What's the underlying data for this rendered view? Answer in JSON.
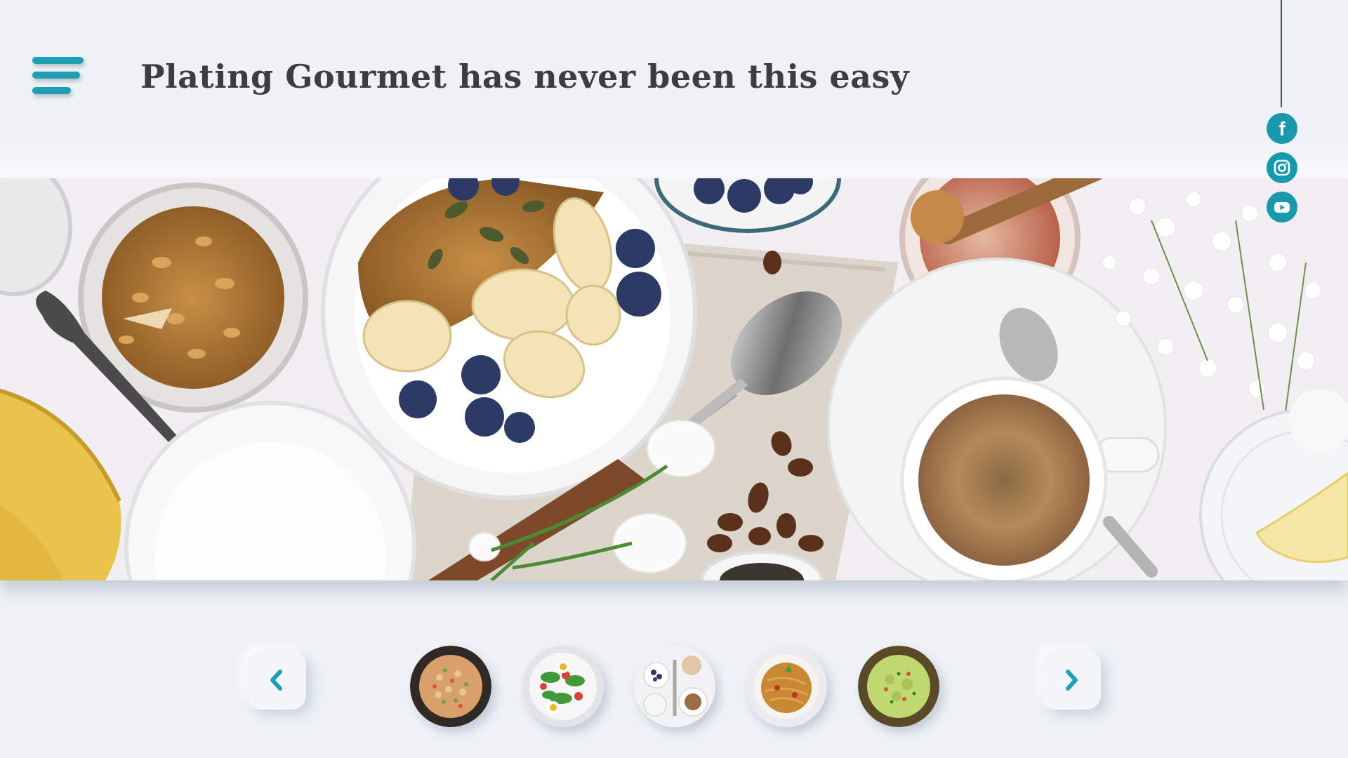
{
  "header": {
    "tagline": "Plating Gourmet has never been this easy",
    "menu_icon": "hamburger-menu-icon"
  },
  "social": {
    "items": [
      {
        "name": "facebook",
        "icon": "facebook-icon"
      },
      {
        "name": "instagram",
        "icon": "instagram-icon"
      },
      {
        "name": "youtube",
        "icon": "youtube-icon"
      }
    ],
    "color": "#1a98ad"
  },
  "hero": {
    "image": "breakfast spread: granola jar, yogurt bowl with banana and blueberries, spoon, honey jar, coffee cup, flowers"
  },
  "carousel": {
    "prev_icon": "chevron-left-icon",
    "next_icon": "chevron-right-icon",
    "thumbnails": [
      {
        "name": "fried-rice"
      },
      {
        "name": "egg-salad"
      },
      {
        "name": "breakfast-table"
      },
      {
        "name": "noodles"
      },
      {
        "name": "guacamole"
      }
    ]
  },
  "colors": {
    "accent": "#1e9fb3",
    "background": "#eef2f6",
    "text": "#3a3e41"
  }
}
